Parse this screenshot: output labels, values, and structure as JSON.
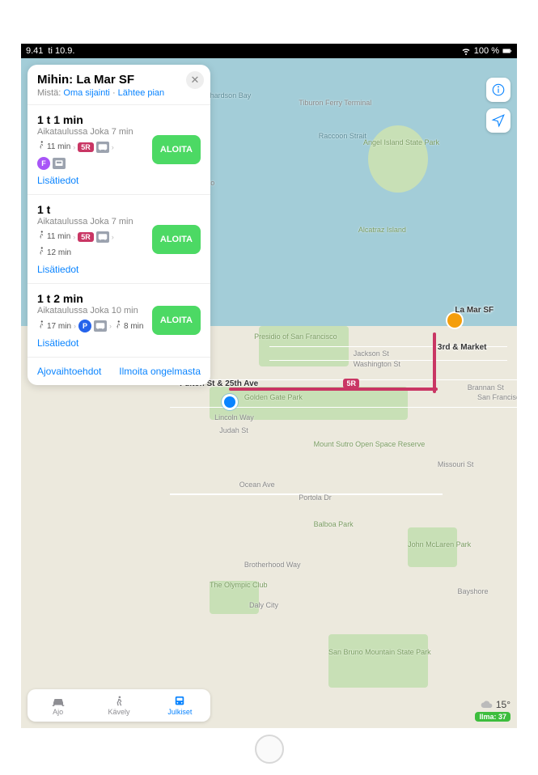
{
  "status": {
    "time": "9.41",
    "date": "ti 10.9.",
    "battery": "100 %"
  },
  "panel": {
    "title_prefix": "Mihin:",
    "destination": "La Mar SF",
    "from_prefix": "Mistä:",
    "from_value": "Oma sijainti",
    "depart": "Lähtee pian"
  },
  "routes": [
    {
      "duration": "1 t 1 min",
      "schedule": "Aikataulussa Joka 7 min",
      "walk1": "11 min",
      "line1": "5R",
      "line2": "F",
      "more": "Lisätiedot",
      "start": "ALOITA"
    },
    {
      "duration": "1 t",
      "schedule": "Aikataulussa Joka 7 min",
      "walk1": "11 min",
      "line1": "5R",
      "walk2": "12 min",
      "more": "Lisätiedot",
      "start": "ALOITA"
    },
    {
      "duration": "1 t 2 min",
      "schedule": "Aikataulussa Joka 10 min",
      "walk1": "17 min",
      "line1": "P",
      "walk2": "8 min",
      "more": "Lisätiedot",
      "start": "ALOITA"
    }
  ],
  "footer": {
    "options": "Ajovaihtoehdot",
    "report": "Ilmoita ongelmasta"
  },
  "tabs": {
    "drive": "Ajo",
    "walk": "Kävely",
    "transit": "Julkiset"
  },
  "map": {
    "labels": {
      "richardson_bay": "Richardson Bay",
      "tiburon": "Tiburon Ferry Terminal",
      "raccoon": "Raccoon Strait",
      "angel_island": "Angel Island State Park",
      "sausalito": "Sausalito",
      "presidio": "Presidio of San Francisco",
      "ggpark": "Golden Gate Park",
      "lincoln": "Lincoln Way",
      "judah": "Judah St",
      "jackson": "Jackson St",
      "washington": "Washington St",
      "fulton25": "Fulton St & 25th Ave",
      "third_market": "3rd & Market",
      "lamar": "La Mar SF",
      "alcatraz": "Alcatraz Island",
      "ocean_ave": "Ocean Ave",
      "portola": "Portola Dr",
      "brotherhood": "Brotherhood Way",
      "daly_city": "Daly City",
      "mclaren": "John McLaren Park",
      "bayshore": "Bayshore",
      "olympic": "The Olympic Club",
      "mtsutro": "Mount Sutro Open Space Reserve",
      "missouri": "Missouri St",
      "brannan": "Brannan St",
      "californian": "San Francisco Californian",
      "sanbruno": "San Bruno Mountain State Park",
      "balboa_park": "Balboa Park",
      "route_5r": "5R"
    }
  },
  "weather": {
    "temp": "15°",
    "aqi_label": "Ilma:",
    "aqi": "37"
  }
}
